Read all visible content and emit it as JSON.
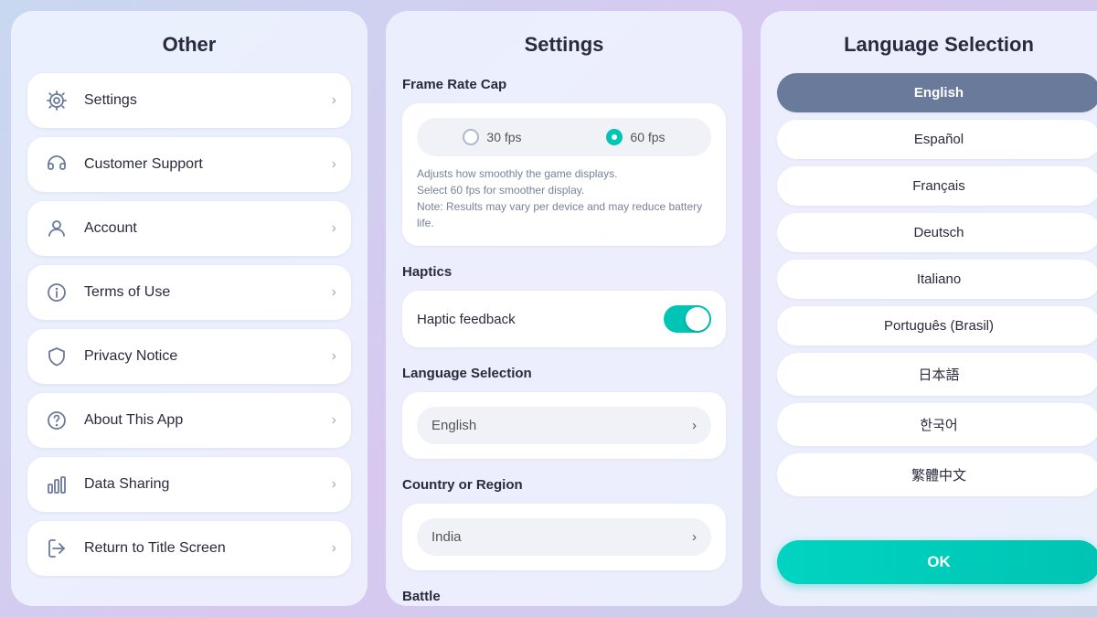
{
  "left": {
    "title": "Other",
    "items": [
      {
        "id": "settings",
        "label": "Settings",
        "icon": "gear"
      },
      {
        "id": "customer-support",
        "label": "Customer Support",
        "icon": "headset"
      },
      {
        "id": "account",
        "label": "Account",
        "icon": "person"
      },
      {
        "id": "terms",
        "label": "Terms of Use",
        "icon": "info"
      },
      {
        "id": "privacy",
        "label": "Privacy Notice",
        "icon": "shield"
      },
      {
        "id": "about",
        "label": "About This App",
        "icon": "question"
      },
      {
        "id": "data",
        "label": "Data Sharing",
        "icon": "chart"
      },
      {
        "id": "return",
        "label": "Return to Title Screen",
        "icon": "exit"
      }
    ]
  },
  "middle": {
    "title": "Settings",
    "frame_rate": {
      "label": "Frame Rate Cap",
      "options": [
        "30 fps",
        "60 fps"
      ],
      "selected": "60 fps",
      "description": "Adjusts how smoothly the game displays.\nSelect 60 fps for smoother display.\nNote: Results may vary per device and may reduce battery life."
    },
    "haptics": {
      "label": "Haptics",
      "feedback_label": "Haptic feedback",
      "enabled": true
    },
    "language": {
      "label": "Language Selection",
      "value": "English"
    },
    "region": {
      "label": "Country or Region",
      "value": "India"
    },
    "battle_label": "Battle"
  },
  "right": {
    "title": "Language Selection",
    "languages": [
      {
        "code": "en",
        "label": "English",
        "selected": true
      },
      {
        "code": "es",
        "label": "Español",
        "selected": false
      },
      {
        "code": "fr",
        "label": "Français",
        "selected": false
      },
      {
        "code": "de",
        "label": "Deutsch",
        "selected": false
      },
      {
        "code": "it",
        "label": "Italiano",
        "selected": false
      },
      {
        "code": "pt",
        "label": "Português (Brasil)",
        "selected": false
      },
      {
        "code": "ja",
        "label": "日本語",
        "selected": false
      },
      {
        "code": "ko",
        "label": "한국어",
        "selected": false
      },
      {
        "code": "zh",
        "label": "繁體中文",
        "selected": false
      }
    ],
    "ok_label": "OK"
  }
}
